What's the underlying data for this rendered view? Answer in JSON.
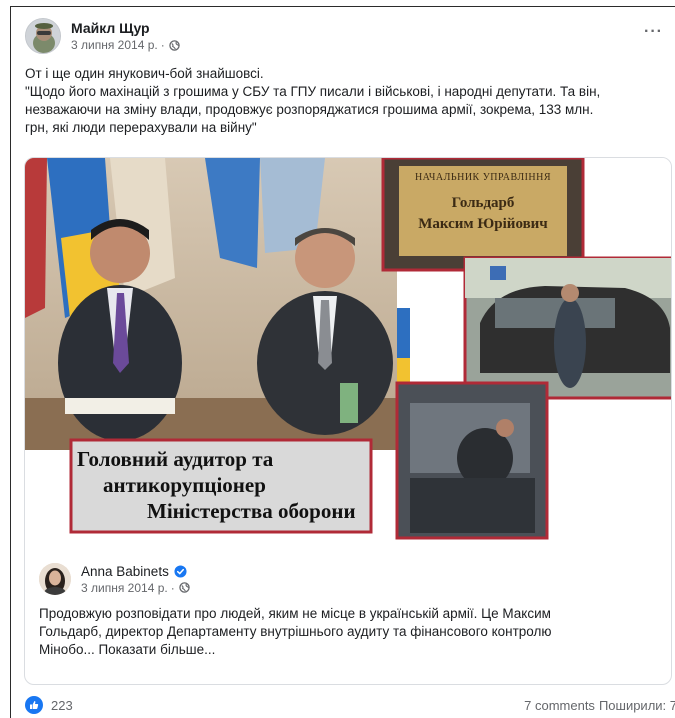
{
  "post": {
    "author": "Майкл Щур",
    "date": "3 липня 2014 р.",
    "more": "···",
    "text_lines": [
      "От і ще один янукович-бой знайшовсі.",
      "\"Щодо його махінацій з грошима у СБУ та ГПУ писали і військові, і народні депутати. Та він,",
      "незважаючи на зміну влади, продовжує розпоряджатися грошима армії, зокрема, 133 млн.",
      "грн, які люди перерахували на війну\""
    ]
  },
  "collage": {
    "caption_lines": [
      "Головний аудитор та",
      "антикорупціонер",
      "Міністерства оборони"
    ],
    "plaque_lines": [
      "НАЧАЛЬНИК УПРАВЛІННЯ",
      "Гольдарб",
      "Максим Юрійович"
    ]
  },
  "shared": {
    "author": "Anna Babinets",
    "date": "3 липня 2014 р.",
    "text_lines": [
      "Продовжую розповідати про людей, яким не місце в українській армії. Це Максим",
      "Гольдарб, директор Департаменту внутрішнього аудиту та фінансового контролю",
      "Мінобо... Показати більше..."
    ]
  },
  "footer": {
    "likes": "223",
    "comments": "7 comments",
    "shares": "Поширили: 7"
  },
  "colors": {
    "like_blue": "#1877f2",
    "meta_gray": "#65676b",
    "caption_border": "#b02a37"
  }
}
